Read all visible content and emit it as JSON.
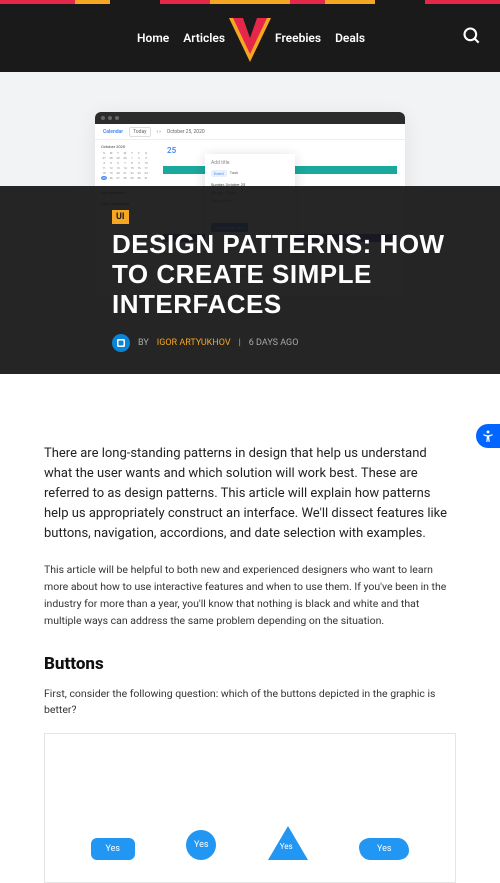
{
  "nav": {
    "home": "Home",
    "articles": "Articles",
    "freebies": "Freebies",
    "deals": "Deals"
  },
  "hero": {
    "calendar_label": "Calendar",
    "today": "Today",
    "date": "October 25, 2020",
    "day_num": "25",
    "month_header": "October 2020",
    "popup_title": "Add title",
    "popup_event": "Event",
    "popup_task": "Task",
    "popup_date": "Sunday, October 25",
    "popup_time_a": "All day",
    "popup_time_b": "Time z",
    "popup_find": "Find a time",
    "popup_btn": "Add Google Mee",
    "sidebar_my": "My calendars",
    "sidebar_other": "Other calendars"
  },
  "article": {
    "badge": "UI",
    "title": "DESIGN PATTERNS: HOW TO CREATE SIMPLE INTERFACES",
    "by_prefix": "BY",
    "author": "IGOR ARTYUKHOV",
    "date": "6 DAYS AGO",
    "lede": "There are long-standing patterns in design that help us understand what the user wants and which solution will work best. These are referred to as design patterns. This article will explain how patterns help us appropriately construct an interface. We'll dissect features like buttons, navigation, accordions, and date selection with examples.",
    "sub": "This article will be helpful to both new and experienced designers who want to learn more about how to use interactive features and when to use them. If you've been in the industry for more than a year, you'll know that nothing is black and white and that multiple ways can address the same problem depending on the situation.",
    "section_buttons": "Buttons",
    "buttons_intro": "First, consider the following question: which of the buttons depicted in the graphic is better?",
    "yes_label": "Yes"
  }
}
